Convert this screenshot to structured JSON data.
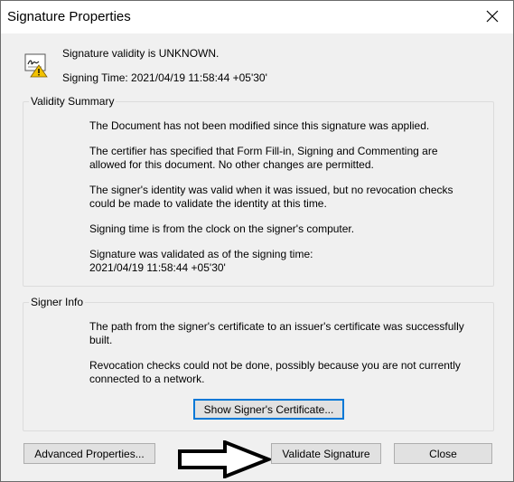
{
  "window": {
    "title": "Signature Properties"
  },
  "header": {
    "validity": "Signature validity is UNKNOWN.",
    "signing_time": "Signing Time:  2021/04/19 11:58:44 +05'30'"
  },
  "validity_summary": {
    "label": "Validity Summary",
    "paragraphs": [
      "The Document has not been modified since this signature was applied.",
      "The certifier has specified that Form Fill-in, Signing and Commenting are allowed for this document. No other changes are permitted.",
      "The signer's identity was valid when it was issued, but no revocation checks could be made to validate the identity at this time.",
      "Signing time is from the clock on the signer's computer.",
      "Signature was validated as of the signing time:",
      "2021/04/19 11:58:44 +05'30'"
    ]
  },
  "signer_info": {
    "label": "Signer Info",
    "paragraphs": [
      "The path from the signer's certificate to an issuer's certificate was successfully built.",
      "Revocation checks could not be done, possibly because you are not currently connected to a network."
    ],
    "show_certificate_label": "Show Signer's Certificate..."
  },
  "buttons": {
    "advanced": "Advanced Properties...",
    "validate": "Validate Signature",
    "close": "Close"
  },
  "icons": {
    "close": "close-icon",
    "signature_warning": "signature-warning-icon",
    "arrow": "arrow-right-icon"
  }
}
